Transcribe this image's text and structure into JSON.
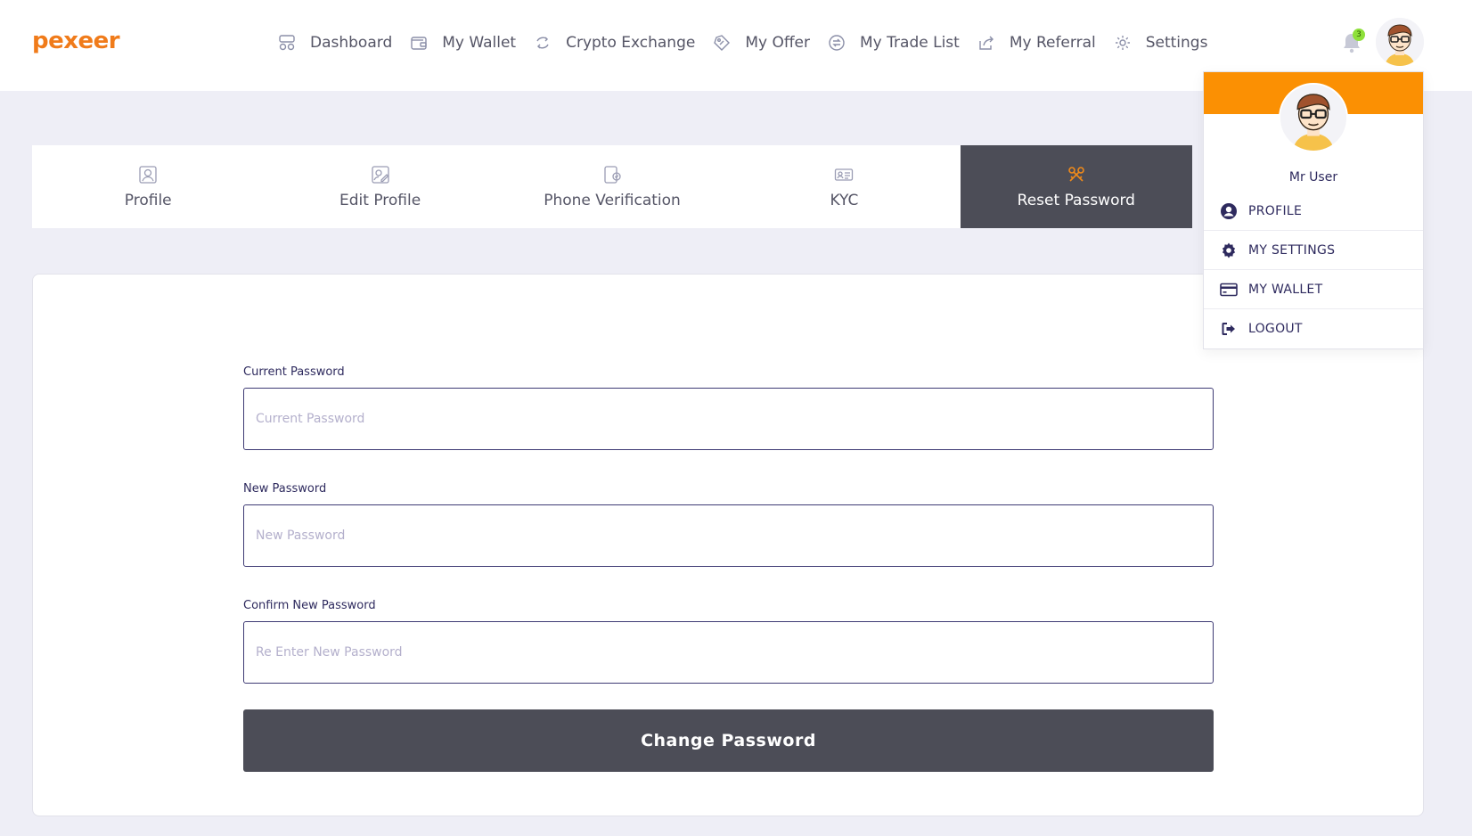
{
  "brand": {
    "logo_text": "pexeer",
    "logo_color": "#f07b1a"
  },
  "nav": {
    "items": [
      {
        "label": "Dashboard",
        "icon": "dashboard-icon"
      },
      {
        "label": "My Wallet",
        "icon": "wallet-icon"
      },
      {
        "label": "Crypto Exchange",
        "icon": "exchange-icon"
      },
      {
        "label": "My Offer",
        "icon": "offer-tag-icon"
      },
      {
        "label": "My Trade List",
        "icon": "trade-list-icon"
      },
      {
        "label": "My Referral",
        "icon": "share-icon"
      },
      {
        "label": "Settings",
        "icon": "gear-icon"
      }
    ]
  },
  "notifications": {
    "count": "3"
  },
  "tabs": {
    "items": [
      {
        "label": "Profile",
        "icon": "profile-icon",
        "active": false
      },
      {
        "label": "Edit Profile",
        "icon": "edit-profile-icon",
        "active": false
      },
      {
        "label": "Phone Verification",
        "icon": "phone-verification-icon",
        "active": false
      },
      {
        "label": "KYC",
        "icon": "id-card-icon",
        "active": false
      },
      {
        "label": "Reset Password",
        "icon": "keys-icon",
        "active": true
      }
    ]
  },
  "form": {
    "current": {
      "label": "Current Password",
      "placeholder": "Current Password",
      "value": ""
    },
    "new": {
      "label": "New Password",
      "placeholder": "New Password",
      "value": ""
    },
    "confirm": {
      "label": "Confirm New Password",
      "placeholder": "Re Enter New Password",
      "value": ""
    },
    "submit_label": "Change Password"
  },
  "user_menu": {
    "user_name": "Mr User",
    "items": [
      {
        "label": "PROFILE",
        "icon": "user-circle-icon"
      },
      {
        "label": "MY SETTINGS",
        "icon": "cog-icon"
      },
      {
        "label": "MY WALLET",
        "icon": "credit-card-icon"
      },
      {
        "label": "LOGOUT",
        "icon": "logout-icon"
      }
    ]
  },
  "colors": {
    "accent_orange": "#fb9003",
    "active_tab_bg": "#4c4d57",
    "button_bg": "#4c4d57",
    "badge_green": "#8ee03a",
    "page_bg": "#eeeef6",
    "text_navy": "#2e2a5e"
  }
}
